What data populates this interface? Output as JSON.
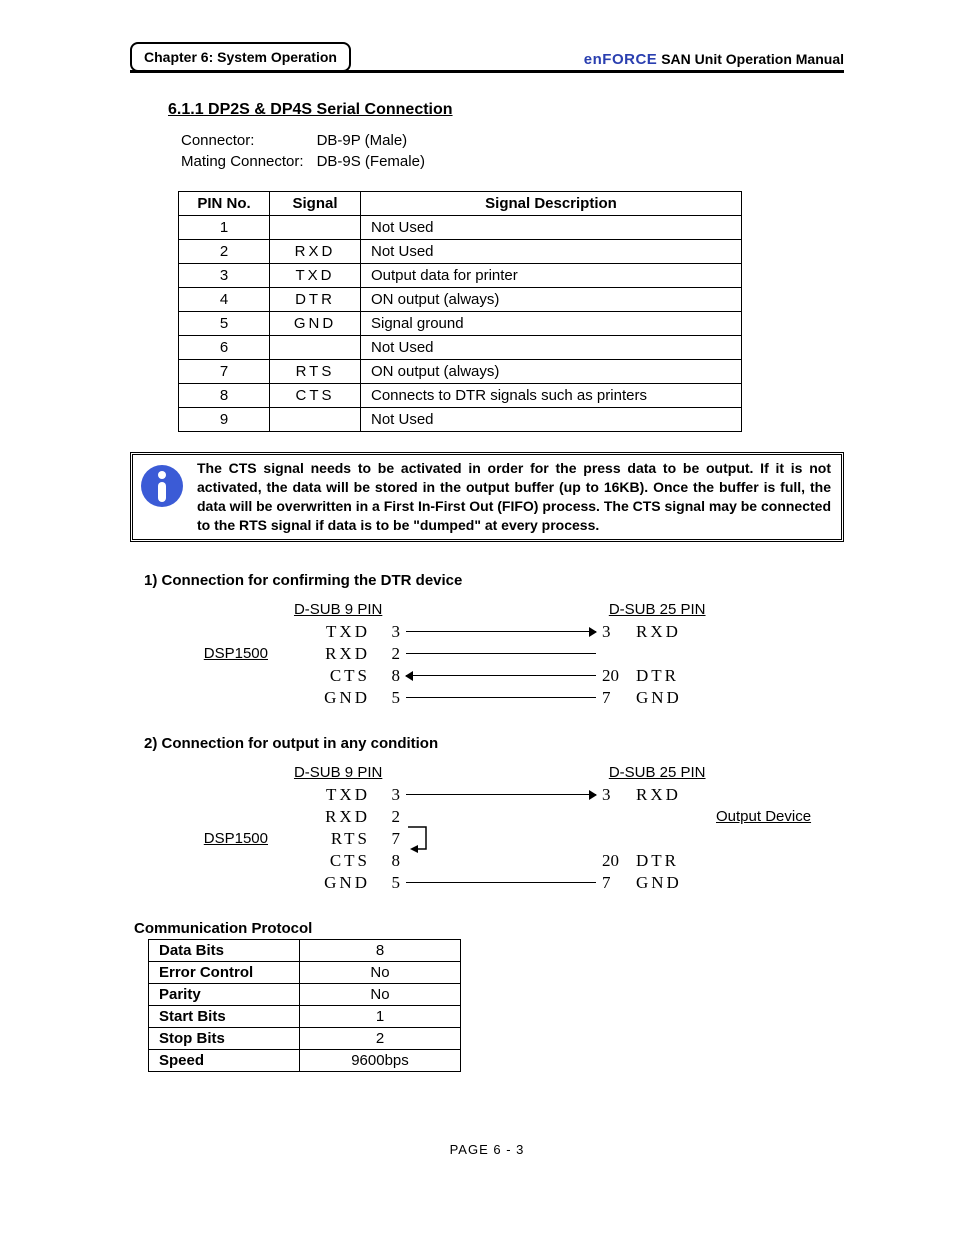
{
  "header": {
    "chapter": "Chapter 6: System Operation",
    "brand": "enFORCE",
    "manual": " SAN  Unit  Operation  Manual"
  },
  "section": {
    "number_title": "6.1.1   DP2S & DP4S Serial Connection",
    "connector_label": "Connector:",
    "connector_value": "DB-9P (Male)",
    "mating_label": "Mating Connector:",
    "mating_value": "DB-9S (Female)"
  },
  "pin_table": {
    "headers": {
      "pin": "PIN No.",
      "signal": "Signal",
      "desc": "Signal Description"
    },
    "rows": [
      {
        "pin": "1",
        "signal": "",
        "desc": "Not Used"
      },
      {
        "pin": "2",
        "signal": "RXD",
        "desc": "Not Used"
      },
      {
        "pin": "3",
        "signal": "TXD",
        "desc": "Output data for printer"
      },
      {
        "pin": "4",
        "signal": "DTR",
        "desc": "ON output (always)"
      },
      {
        "pin": "5",
        "signal": "GND",
        "desc": "Signal ground"
      },
      {
        "pin": "6",
        "signal": "",
        "desc": "Not Used"
      },
      {
        "pin": "7",
        "signal": "RTS",
        "desc": "ON output (always)"
      },
      {
        "pin": "8",
        "signal": "CTS",
        "desc": "Connects to DTR signals such as printers"
      },
      {
        "pin": "9",
        "signal": "",
        "desc": "Not Used"
      }
    ]
  },
  "note": "The CTS signal needs to be activated in order for the press data to be output. If it is not activated, the data will be stored in the output buffer (up to 16KB). Once the buffer is full, the data will be overwritten in a First In-First Out (FIFO) process. The CTS signal may be connected to the RTS signal if data is to be \"dumped\" at every process.",
  "wiring1": {
    "heading": "1) Connection for confirming the DTR device",
    "device": "DSP1500",
    "left_header": "D-SUB 9 PIN",
    "right_header": "D-SUB 25 PIN",
    "rows": [
      {
        "ls": "TXD",
        "lp": "3",
        "rp": "3",
        "rs": "RXD",
        "arrow": "r"
      },
      {
        "ls": "RXD",
        "lp": "2",
        "rp": "",
        "rs": "",
        "arrow": ""
      },
      {
        "ls": "CTS",
        "lp": "8",
        "rp": "20",
        "rs": "DTR",
        "arrow": "l"
      },
      {
        "ls": "GND",
        "lp": "5",
        "rp": "7",
        "rs": "GND",
        "arrow": ""
      }
    ]
  },
  "wiring2": {
    "heading": "2) Connection for output in any condition",
    "device": "DSP1500",
    "output_device": "Output Device",
    "left_header": "D-SUB 9 PIN",
    "right_header": "D-SUB 25 PIN",
    "rows": [
      {
        "ls": "TXD",
        "lp": "3",
        "rp": "3",
        "rs": "RXD",
        "arrow": "r",
        "line": true
      },
      {
        "ls": "RXD",
        "lp": "2",
        "rp": "",
        "rs": "",
        "arrow": "",
        "line": false
      },
      {
        "ls": "RTS",
        "lp": "7",
        "rp": "",
        "rs": "",
        "arrow": "",
        "line": false,
        "loop": "top"
      },
      {
        "ls": "CTS",
        "lp": "8",
        "rp": "20",
        "rs": "DTR",
        "arrow": "",
        "line": false,
        "loop": "bot"
      },
      {
        "ls": "GND",
        "lp": "5",
        "rp": "7",
        "rs": "GND",
        "arrow": "",
        "line": true
      }
    ]
  },
  "protocol": {
    "heading": "Communication Protocol",
    "rows": [
      {
        "label": "Data Bits",
        "value": "8"
      },
      {
        "label": "Error Control",
        "value": "No"
      },
      {
        "label": "Parity",
        "value": "No"
      },
      {
        "label": "Start Bits",
        "value": "1"
      },
      {
        "label": "Stop Bits",
        "value": "2"
      },
      {
        "label": "Speed",
        "value": "9600bps"
      }
    ]
  },
  "footer": "PAGE 6 - 3"
}
